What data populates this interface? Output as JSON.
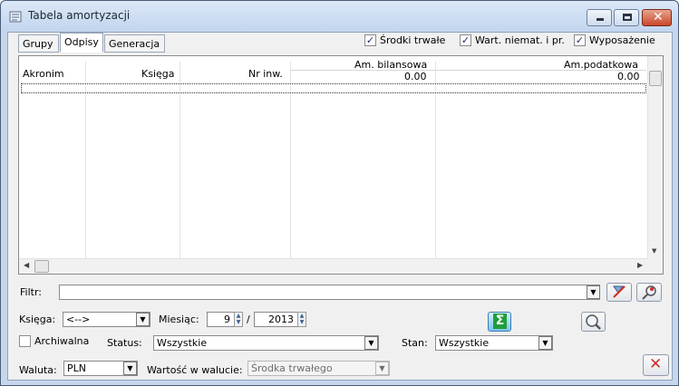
{
  "window": {
    "title": "Tabela amortyzacji",
    "minimize_icon": "minimize-icon",
    "maximize_icon": "maximize-icon",
    "close_icon": "close-icon"
  },
  "tabs": [
    {
      "label": "Grupy",
      "active": false
    },
    {
      "label": "Odpisy",
      "active": true
    },
    {
      "label": "Generacja",
      "active": false
    }
  ],
  "filters_top": [
    {
      "label": "Środki trwałe",
      "checked": true
    },
    {
      "label": "Wart. niemat. i pr.",
      "checked": true
    },
    {
      "label": "Wyposażenie",
      "checked": true
    }
  ],
  "grid": {
    "columns": [
      "Akronim",
      "Księga",
      "Nr inw.",
      "Am. bilansowa",
      "Am.podatkowa"
    ],
    "totals": {
      "am_bilansowa": "0.00",
      "am_podatkowa": "0.00"
    },
    "rows": []
  },
  "filter": {
    "label": "Filtr:",
    "value": ""
  },
  "controls": {
    "ksiega_label": "Księga:",
    "ksiega_value": "<-->",
    "miesiac_label": "Miesiąc:",
    "miesiac_value": "9",
    "separator": "/",
    "rok_value": "2013",
    "archiwalna_label": "Archiwalna",
    "archiwalna_checked": false,
    "status_label": "Status:",
    "status_value": "Wszystkie",
    "stan_label": "Stan:",
    "stan_value": "Wszystkie",
    "waluta_label": "Waluta:",
    "waluta_value": "PLN",
    "wartosc_label": "Wartość w walucie:",
    "wartosc_value": "Środka trwałego"
  },
  "colors": {
    "sigma_green": "#1f9e3c",
    "close_red": "#c9302c"
  }
}
